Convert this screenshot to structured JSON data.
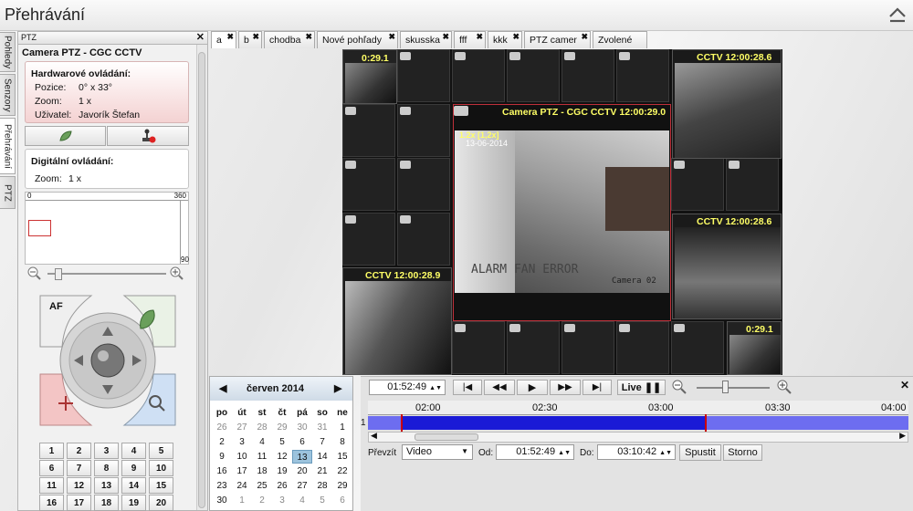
{
  "app": {
    "title": "Přehrávání"
  },
  "side_tabs": [
    "Pohledy",
    "Senzory",
    "Přehrávání",
    "PTZ"
  ],
  "ptz": {
    "header": "PTZ",
    "camera": "Camera PTZ - CGC CCTV",
    "hardware": {
      "title": "Hardwarové ovládání:",
      "position_label": "Pozice:",
      "position": "0° x 33°",
      "zoom_label": "Zoom:",
      "zoom": "1 x",
      "user_label": "Uživatel:",
      "user": "Javorík Štefan"
    },
    "digital": {
      "title": "Digitální ovládání:",
      "zoom_label": "Zoom:",
      "zoom": "1 x"
    },
    "map": {
      "min": "0",
      "max": "360",
      "bottom": "90"
    },
    "af_label": "AF",
    "keypad": [
      "1",
      "2",
      "3",
      "4",
      "5",
      "6",
      "7",
      "8",
      "9",
      "10",
      "11",
      "12",
      "13",
      "14",
      "15",
      "16",
      "17",
      "18",
      "19",
      "20"
    ]
  },
  "tabs": [
    "a",
    "b",
    "chodba",
    "Nové pohľady",
    "skusska",
    "fff",
    "kkk",
    "PTZ camer",
    "Zvolené"
  ],
  "grid": {
    "main_label": "Camera PTZ - CGC CCTV 12:00:29.0",
    "main_overlay": "1.2x [1,2x]",
    "main_date": "13-06-2014",
    "main_error": "ALARM FAN ERROR",
    "main_cam": "Camera 02",
    "tl_label": "0:29.1",
    "tr_label": "CCTV 12:00:28.6",
    "r2_label": "CCTV 12:00:28.6",
    "bl_label": "CCTV 12:00:28.9",
    "br_label": "0:29.1"
  },
  "calendar": {
    "month": "červen 2014",
    "weekdays": [
      "po",
      "út",
      "st",
      "čt",
      "pá",
      "so",
      "ne"
    ],
    "days": [
      [
        "26",
        "27",
        "28",
        "29",
        "30",
        "31",
        "1"
      ],
      [
        "2",
        "3",
        "4",
        "5",
        "6",
        "7",
        "8"
      ],
      [
        "9",
        "10",
        "11",
        "12",
        "13",
        "14",
        "15"
      ],
      [
        "16",
        "17",
        "18",
        "19",
        "20",
        "21",
        "22"
      ],
      [
        "23",
        "24",
        "25",
        "26",
        "27",
        "28",
        "29"
      ],
      [
        "30",
        "1",
        "2",
        "3",
        "4",
        "5",
        "6"
      ]
    ],
    "selected": "13"
  },
  "timeline": {
    "time": "01:52:49",
    "live_label": "Live",
    "ticks": [
      "02:00",
      "02:30",
      "03:00",
      "03:30",
      "04:00"
    ],
    "track": "1",
    "prevzit_label": "Převzít",
    "format": "Video",
    "from_label": "Od:",
    "from": "01:52:49",
    "to_label": "Do:",
    "to": "03:10:42",
    "start_label": "Spustit",
    "cancel_label": "Storno"
  },
  "colors": {
    "accent": "#1a1ad6",
    "marker": "#cc0000",
    "selected_day": "#9cc3dd",
    "cam_label": "#ffff66"
  }
}
